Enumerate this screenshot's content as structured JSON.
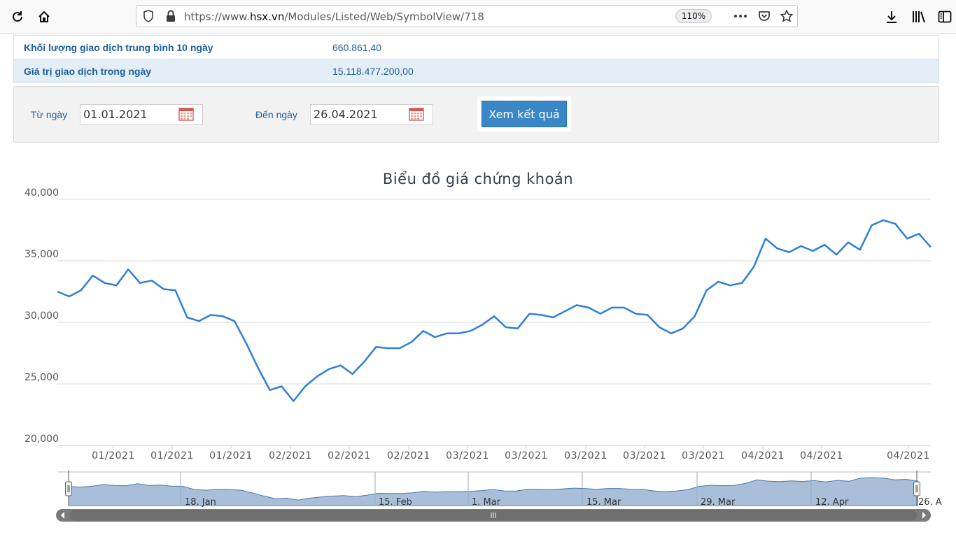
{
  "browser": {
    "url_prefix": "https://www.",
    "url_domain": "hsx.vn",
    "url_path": "/Modules/Listed/Web/SymbolView/718",
    "zoom": "110%"
  },
  "info_rows": [
    {
      "label": "Khối lượng giao dịch trung bình 10 ngày",
      "value": "660.861,40"
    },
    {
      "label": "Giá trị giao dịch trong ngày",
      "value": "15.118.477.200,00"
    }
  ],
  "filter": {
    "from_label": "Từ ngày",
    "from_value": "01.01.2021",
    "to_label": "Đến ngày",
    "to_value": "26.04.2021",
    "submit_label": "Xem kết quả"
  },
  "colors": {
    "line": "#2f7ed8",
    "navigator_fill": "#a9bfd9",
    "accent": "#3a87c8"
  },
  "chart_data": {
    "type": "line",
    "title": "Biểu đồ giá chứng khoán",
    "ylim": [
      20000,
      40000
    ],
    "y_ticks": [
      "20,000",
      "25,000",
      "30,000",
      "35,000",
      "40,000"
    ],
    "x_tick_labels": [
      "01/2021",
      "01/2021",
      "01/2021",
      "02/2021",
      "02/2021",
      "02/2021",
      "03/2021",
      "03/2021",
      "03/2021",
      "03/2021",
      "03/2021",
      "04/2021",
      "04/2021",
      "04/2021"
    ],
    "navigator_labels": [
      "18. Jan",
      "15. Feb",
      "1. Mar",
      "15. Mar",
      "29. Mar",
      "12. Apr",
      "26. A"
    ],
    "grid": true,
    "series": [
      {
        "values": [
          32500,
          32100,
          32600,
          33800,
          33200,
          33000,
          34300,
          33200,
          33400,
          32700,
          32600,
          30400,
          30100,
          30600,
          30500,
          30100,
          28300,
          26300,
          24500,
          24800,
          23600,
          24800,
          25600,
          26200,
          26500,
          25800,
          26800,
          28000,
          27900,
          27900,
          28400,
          29300,
          28800,
          29100,
          29100,
          29300,
          29800,
          30500,
          29600,
          29500,
          30700,
          30600,
          30400,
          30900,
          31400,
          31200,
          30700,
          31200,
          31200,
          30700,
          30600,
          29600,
          29100,
          29500,
          30500,
          32600,
          33300,
          33000,
          33200,
          34500,
          36800,
          36000,
          35700,
          36200,
          35800,
          36300,
          35500,
          36500,
          35900,
          37900,
          38300,
          38000,
          36800,
          37200,
          36100
        ]
      }
    ]
  }
}
